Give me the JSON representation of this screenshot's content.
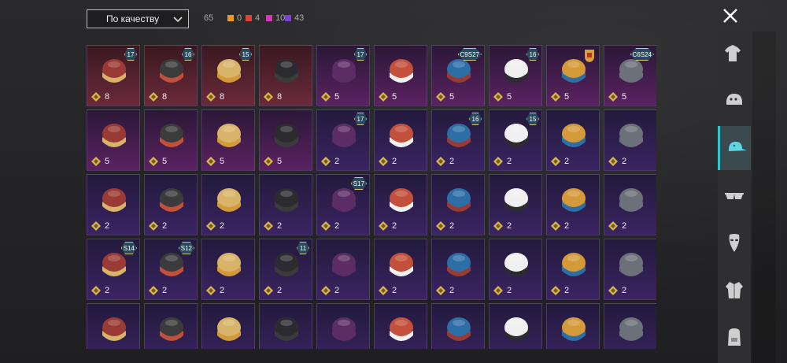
{
  "sort": {
    "label": "По качеству"
  },
  "counts": {
    "total": "65",
    "qualities": [
      {
        "name": "orange",
        "color": "#e89a25",
        "count": "0"
      },
      {
        "name": "red",
        "color": "#e2403a",
        "count": "4"
      },
      {
        "name": "pink",
        "color": "#d23ab4",
        "count": "10"
      },
      {
        "name": "purple",
        "color": "#7a42d9",
        "count": "43"
      }
    ]
  },
  "colors": {
    "accent": "#33c7d6",
    "red_tier_bg": "#5a2430",
    "purple_tier_bg": "#3a2356"
  },
  "sidebar": [
    {
      "name": "outfit",
      "icon": "outfit-icon",
      "active": false
    },
    {
      "name": "helmet",
      "icon": "helmet-icon",
      "active": false
    },
    {
      "name": "hat",
      "icon": "cap-icon",
      "active": true
    },
    {
      "name": "glasses",
      "icon": "sunglasses-icon",
      "active": false
    },
    {
      "name": "mask",
      "icon": "mask-icon",
      "active": false
    },
    {
      "name": "jacket",
      "icon": "jacket-icon",
      "active": false
    },
    {
      "name": "backpack",
      "icon": "backpack-icon",
      "active": false
    }
  ],
  "items": [
    {
      "count": "8",
      "tier": "red",
      "badge": "17",
      "art": "hood-horns"
    },
    {
      "count": "8",
      "tier": "red",
      "badge": "16",
      "art": "cat-hat"
    },
    {
      "count": "8",
      "tier": "red",
      "badge": "15",
      "art": "blonde-hair"
    },
    {
      "count": "8",
      "tier": "red",
      "badge": "",
      "art": "helmet-dark"
    },
    {
      "count": "5",
      "tier": "pink",
      "badge": "17",
      "art": "blonde-cap"
    },
    {
      "count": "5",
      "tier": "pink",
      "badge": "",
      "art": "pigtails"
    },
    {
      "count": "5",
      "tier": "pink",
      "badge": "C9S27",
      "art": "bunny-helmet"
    },
    {
      "count": "5",
      "tier": "pink",
      "badge": "16",
      "art": "black-hood"
    },
    {
      "count": "5",
      "tier": "pink",
      "badge": "porsche",
      "art": "racing-helmet"
    },
    {
      "count": "5",
      "tier": "pink",
      "badge": "C6S24",
      "art": "dark-hair"
    },
    {
      "count": "5",
      "tier": "pink",
      "badge": "",
      "art": "pink-hair"
    },
    {
      "count": "5",
      "tier": "pink",
      "badge": "",
      "art": "moto-helmet"
    },
    {
      "count": "5",
      "tier": "pink",
      "badge": "",
      "art": "bunny-ears"
    },
    {
      "count": "5",
      "tier": "pink",
      "badge": "",
      "art": "bandana"
    },
    {
      "count": "2",
      "tier": "purple",
      "badge": "17",
      "art": "sun-hat"
    },
    {
      "count": "2",
      "tier": "purple",
      "badge": "",
      "art": "ponytail"
    },
    {
      "count": "2",
      "tier": "purple",
      "badge": "16",
      "art": "goggles-hair"
    },
    {
      "count": "2",
      "tier": "purple",
      "badge": "15",
      "art": "red-hair"
    },
    {
      "count": "2",
      "tier": "purple",
      "badge": "",
      "art": "black-cap"
    },
    {
      "count": "2",
      "tier": "purple",
      "badge": "",
      "art": "cat-ears"
    },
    {
      "count": "2",
      "tier": "purple",
      "badge": "",
      "art": "beanie-hair"
    },
    {
      "count": "2",
      "tier": "purple",
      "badge": "",
      "art": "mesh-cap"
    },
    {
      "count": "2",
      "tier": "purple",
      "badge": "",
      "art": "red-cap"
    },
    {
      "count": "2",
      "tier": "purple",
      "badge": "",
      "art": "bucket-hair"
    },
    {
      "count": "2",
      "tier": "purple",
      "badge": "S17",
      "art": "knight-helm"
    },
    {
      "count": "2",
      "tier": "purple",
      "badge": "",
      "art": "mohawk"
    },
    {
      "count": "2",
      "tier": "purple",
      "badge": "",
      "art": "sombrero"
    },
    {
      "count": "2",
      "tier": "purple",
      "badge": "",
      "art": "white-beanie"
    },
    {
      "count": "2",
      "tier": "purple",
      "badge": "",
      "art": "orange-beanie"
    },
    {
      "count": "2",
      "tier": "purple",
      "badge": "",
      "art": "mushroom"
    },
    {
      "count": "2",
      "tier": "purple",
      "badge": "S14",
      "art": "gray-helm"
    },
    {
      "count": "2",
      "tier": "purple",
      "badge": "S12",
      "art": "space-helm"
    },
    {
      "count": "2",
      "tier": "purple",
      "badge": "",
      "art": "knit-cap"
    },
    {
      "count": "2",
      "tier": "purple",
      "badge": "11",
      "art": "boonie"
    },
    {
      "count": "2",
      "tier": "purple",
      "badge": "",
      "art": "navy-cap"
    },
    {
      "count": "2",
      "tier": "purple",
      "badge": "",
      "art": "visor"
    },
    {
      "count": "2",
      "tier": "purple",
      "badge": "",
      "art": "army-helmet"
    },
    {
      "count": "2",
      "tier": "purple",
      "badge": "",
      "art": "yellow-hat"
    },
    {
      "count": "2",
      "tier": "purple",
      "badge": "",
      "art": "samurai"
    },
    {
      "count": "2",
      "tier": "purple",
      "badge": "",
      "art": "feather-hat"
    },
    {
      "count": "",
      "tier": "purple",
      "badge": "",
      "art": "luchador"
    },
    {
      "count": "",
      "tier": "purple",
      "badge": "",
      "art": "top-hat"
    },
    {
      "count": "",
      "tier": "purple",
      "badge": "",
      "art": "fedora"
    },
    {
      "count": "",
      "tier": "purple",
      "badge": "",
      "art": "shark"
    },
    {
      "count": "",
      "tier": "purple",
      "badge": "",
      "art": "flower-crown"
    },
    {
      "count": "",
      "tier": "purple",
      "badge": "",
      "art": "red-bucket"
    },
    {
      "count": "",
      "tier": "purple",
      "badge": "",
      "art": "cake-hat"
    },
    {
      "count": "",
      "tier": "purple",
      "badge": "",
      "art": "burger-hat"
    },
    {
      "count": "",
      "tier": "purple",
      "badge": "",
      "art": "headlamp"
    },
    {
      "count": "",
      "tier": "purple",
      "badge": "",
      "art": "box-head"
    }
  ]
}
